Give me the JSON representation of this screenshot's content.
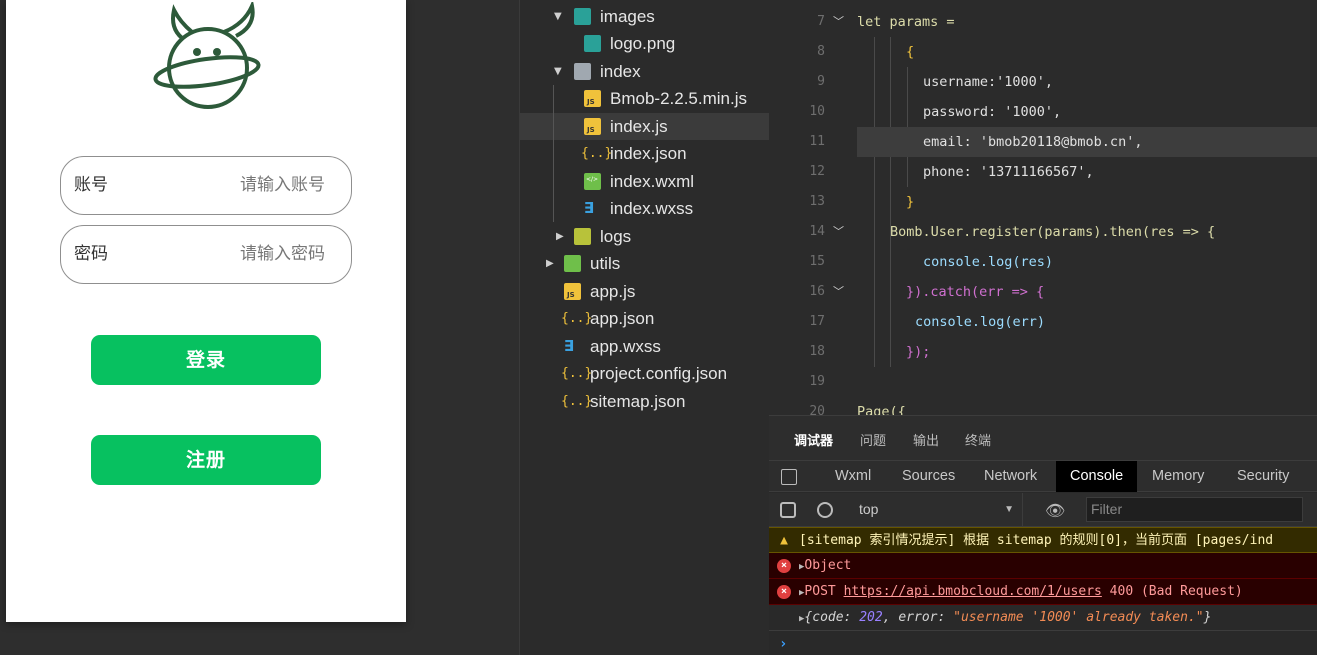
{
  "simulator": {
    "account_label": "账号",
    "account_placeholder": "请输入账号",
    "password_label": "密码",
    "password_placeholder": "请输入密码",
    "login_button": "登录",
    "register_button": "注册",
    "accent_color": "#07c160"
  },
  "file_tree": {
    "items": [
      {
        "name": "images",
        "icon": "folder-image-icon",
        "expanded": true
      },
      {
        "name": "logo.png",
        "icon": "image-file-icon"
      },
      {
        "name": "index",
        "icon": "folder-icon",
        "expanded": true
      },
      {
        "name": "Bmob-2.2.5.min.js",
        "icon": "js-file-icon"
      },
      {
        "name": "index.js",
        "icon": "js-file-icon",
        "selected": true
      },
      {
        "name": "index.json",
        "icon": "json-file-icon"
      },
      {
        "name": "index.wxml",
        "icon": "wxml-file-icon"
      },
      {
        "name": "index.wxss",
        "icon": "css-file-icon"
      },
      {
        "name": "logs",
        "icon": "folder-icon",
        "expanded": false
      },
      {
        "name": "utils",
        "icon": "folder-icon",
        "expanded": false
      },
      {
        "name": "app.js",
        "icon": "js-file-icon"
      },
      {
        "name": "app.json",
        "icon": "json-file-icon"
      },
      {
        "name": "app.wxss",
        "icon": "css-file-icon"
      },
      {
        "name": "project.config.json",
        "icon": "json-file-icon"
      },
      {
        "name": "sitemap.json",
        "icon": "json-file-icon"
      }
    ]
  },
  "editor": {
    "line_numbers": [
      "7",
      "8",
      "9",
      "10",
      "11",
      "12",
      "13",
      "14",
      "15",
      "16",
      "17",
      "18",
      "19",
      "20"
    ],
    "lines": [
      "let params =",
      "{",
      "username:'1000',",
      "password: '1000',",
      "email: 'bmob20118@bmob.cn',",
      "phone: '13711166567',",
      "}",
      "Bomb.User.register(params).then(res => {",
      "console.log(res)",
      "}).catch(err => {",
      "console.log(err)",
      "});",
      "",
      "Page({"
    ]
  },
  "debugger": {
    "panel_tabs": [
      "调试器",
      "问题",
      "输出",
      "终端"
    ],
    "devtools_tabs": [
      "Wxml",
      "Sources",
      "Network",
      "Console",
      "Memory",
      "Security"
    ],
    "active_devtools_tab": "Console",
    "context": "top",
    "filter_placeholder": "Filter",
    "logs": {
      "warning": "[sitemap 索引情况提示] 根据 sitemap 的规则[0]，当前页面 [pages/ind",
      "object": "Object",
      "post_method": "POST",
      "post_url": "https://api.bmobcloud.com/1/users",
      "post_status": "400 (Bad Request)",
      "result_prefix": "{code: ",
      "result_code": "202",
      "result_mid": ", error: ",
      "result_error": "\"username '1000' already taken.\"",
      "result_suffix": "}"
    }
  }
}
